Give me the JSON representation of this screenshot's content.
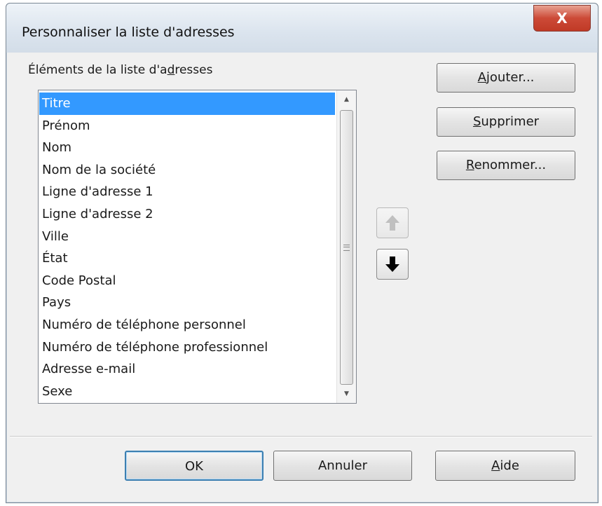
{
  "window": {
    "title": "Personnaliser la liste d'adresses",
    "close_label": "X"
  },
  "list_section": {
    "label_before": "Éléments de la liste d'a",
    "label_mnemonic": "d",
    "label_after": "resses",
    "items": [
      "Titre",
      "Prénom",
      "Nom",
      "Nom de la société",
      "Ligne d'adresse 1",
      "Ligne d'adresse 2",
      "Ville",
      "État",
      "Code Postal",
      "Pays",
      "Numéro de téléphone personnel",
      "Numéro de téléphone professionnel",
      "Adresse e-mail",
      "Sexe"
    ],
    "selected_index": 0
  },
  "side_buttons": {
    "add": {
      "mnemonic": "A",
      "rest": "jouter..."
    },
    "delete": {
      "mnemonic": "S",
      "rest": "upprimer"
    },
    "rename": {
      "mnemonic": "R",
      "rest": "enommer..."
    }
  },
  "move_buttons": {
    "up_icon": "arrow-up-icon",
    "down_icon": "arrow-down-icon"
  },
  "footer": {
    "ok_label": "OK",
    "cancel_label": "Annuler",
    "help_mnemonic": "A",
    "help_rest": "ide"
  },
  "colors": {
    "selection": "#3399ff",
    "close_button": "#cc4a37",
    "dialog_background": "#f0f0f0"
  }
}
